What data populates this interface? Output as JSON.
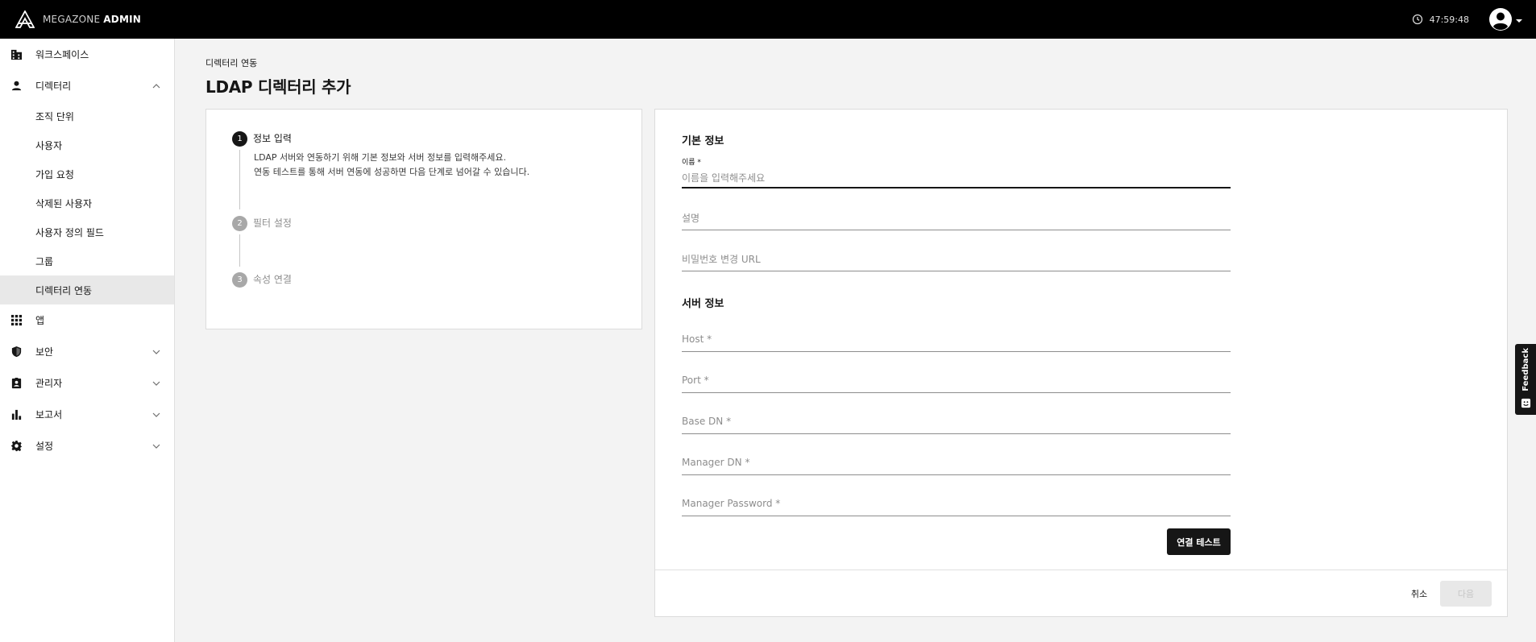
{
  "header": {
    "brand_light": "MEGAZONE",
    "brand_bold": "ADMIN",
    "timer": "47:59:48",
    "icons": {
      "logo": "megazone-logo-icon",
      "timer": "session-clock-icon",
      "user": "account-circle-icon"
    }
  },
  "sidebar": {
    "workspace": "워크스페이스",
    "directory": "디렉터리",
    "directory_items": [
      "조직 단위",
      "사용자",
      "가입 요청",
      "삭제된 사용자",
      "사용자 정의 필드",
      "그룹",
      "디렉터리 연동"
    ],
    "active_item": "디렉터리 연동",
    "apps": "앱",
    "security": "보안",
    "admin": "관리자",
    "reports": "보고서",
    "settings": "설정"
  },
  "page": {
    "breadcrumb": "디렉터리 연동",
    "title": "LDAP 디렉터리 추가"
  },
  "steps": [
    {
      "num": "1",
      "title": "정보 입력",
      "active": true
    },
    {
      "num": "2",
      "title": "필터 설정",
      "active": false
    },
    {
      "num": "3",
      "title": "속성 연결",
      "active": false
    }
  ],
  "step_desc": {
    "line1": "LDAP 서버와 연동하기 위해 기본 정보와 서버 정보를 입력해주세요.",
    "line2": "연동 테스트를 통해 서버 연동에 성공하면 다음 단계로 넘어갈 수 있습니다."
  },
  "form": {
    "basic_title": "기본 정보",
    "name_label": "이름 *",
    "name_placeholder": "이름을 입력해주세요",
    "description_placeholder": "설명",
    "password_url_placeholder": "비밀번호 변경 URL",
    "server_title": "서버 정보",
    "host_placeholder": "Host *",
    "port_placeholder": "Port *",
    "base_dn_placeholder": "Base DN *",
    "manager_dn_placeholder": "Manager DN *",
    "manager_password_placeholder": "Manager Password *",
    "test_button": "연결 테스트",
    "cancel_button": "취소",
    "next_button": "다음"
  },
  "feedback": {
    "label": "Feedback"
  }
}
